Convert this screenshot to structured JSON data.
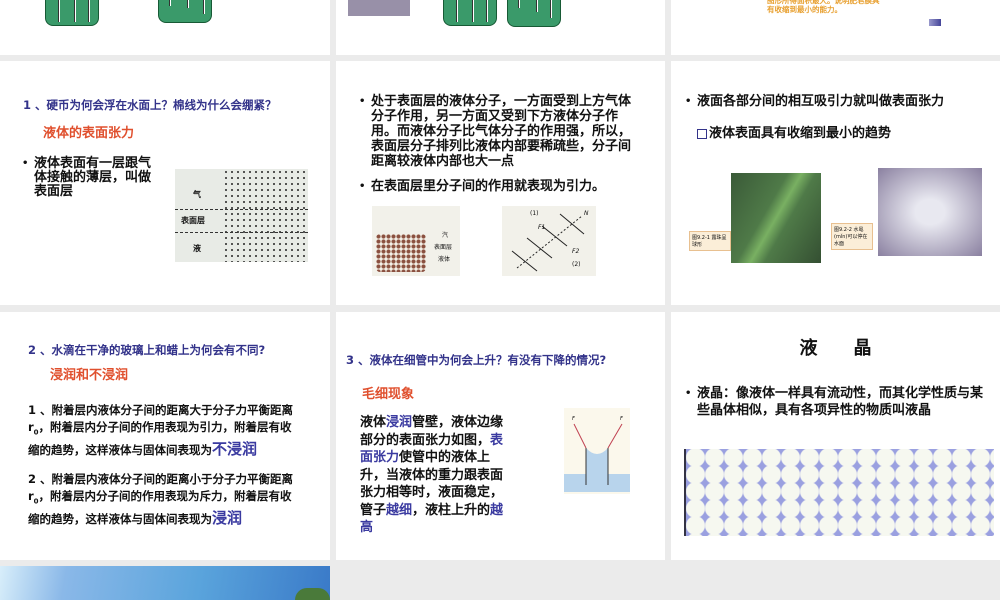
{
  "slides": [
    {
      "id": "partial-top-left"
    },
    {
      "id": "partial-top-middle"
    },
    {
      "id": "partial-top-right",
      "caption": "图形所得面积最大。说明肥皂膜具有收缩到最小的能力。"
    },
    {
      "id": "surface-layer",
      "question": "1 、硬币为何会浮在水面上？棉线为什么会绷紧？",
      "subtitle": "液体的表面张力",
      "bullet": "液体表面有一层跟气体接触的薄层，叫做表面层",
      "figure_labels": [
        "气",
        "表面层",
        "液"
      ]
    },
    {
      "id": "molecular-force",
      "bullets": [
        "处于表面层的液体分子，一方面受到上方气体分子作用，另一方面又受到下方液体分子作用。而液体分子比气体分子的作用强，所以，表面层分子排列比液体内部要稀疏些，分子间距离较液体内部也大一点",
        "在表面层里分子间的作用就表现为引力。"
      ],
      "figure_labels": [
        "汽",
        "表面层",
        "液体",
        "(1)",
        "(2)",
        "N",
        "F1",
        "F2"
      ]
    },
    {
      "id": "surface-tension",
      "bullet": "液面各部分间的相互吸引力就叫做表面张力",
      "sub_bullet": "液体表面具有收缩到最小的趋势",
      "captions": [
        "图9.2-1 露珠呈球形",
        "图9.2-2 水黾(mǐn)可以停在水面"
      ]
    },
    {
      "id": "wetting",
      "question": "2 、水滴在干净的玻璃上和蜡上为何会有不同?",
      "subtitle": "浸润和不浸润",
      "p1": "1 、附着层内液体分子间的距离大于分子力平衡距离 r",
      "p1b": "，附着层内分子间的作用表现为引力，附着层有收缩的趋势，这样液体与固体间表现为",
      "p1_term": "不浸润",
      "p2": "2 、附着层内液体分子间的距离小于分子力平衡距离 r",
      "p2b": "，附着层内分子间的作用表现为斥力，附着层有收缩的趋势，这样液体与固体间表现为",
      "p2_term": "浸润",
      "sub": "0"
    },
    {
      "id": "capillary",
      "question": "3 、液体在细管中为何会上升？有没有下降的情况?",
      "subtitle": "毛细现象",
      "t1": "液体",
      "t2": "浸润",
      "t3": "管壁，液体边缘部分的表面张力如图，",
      "t4": "表面张力",
      "t5": "使管中的液体上升，当液体的重力跟表面张力相等时，液面稳定，管子",
      "t6": "越细",
      "t7": "，液柱上升的",
      "t8": "越高",
      "figure_labels": [
        "F",
        "F"
      ]
    },
    {
      "id": "liquid-crystal",
      "title": "液　　晶",
      "bullet": "液晶：像液体一样具有流动性，而其化学性质与某些晶体相似，具有各项异性的物质叫液晶"
    },
    {
      "id": "partial-bottom-left"
    }
  ],
  "colors": {
    "background": "#ebebeb",
    "question": "#33338a",
    "subtitle": "#e0502e",
    "highlight": "#3a3aa0"
  }
}
